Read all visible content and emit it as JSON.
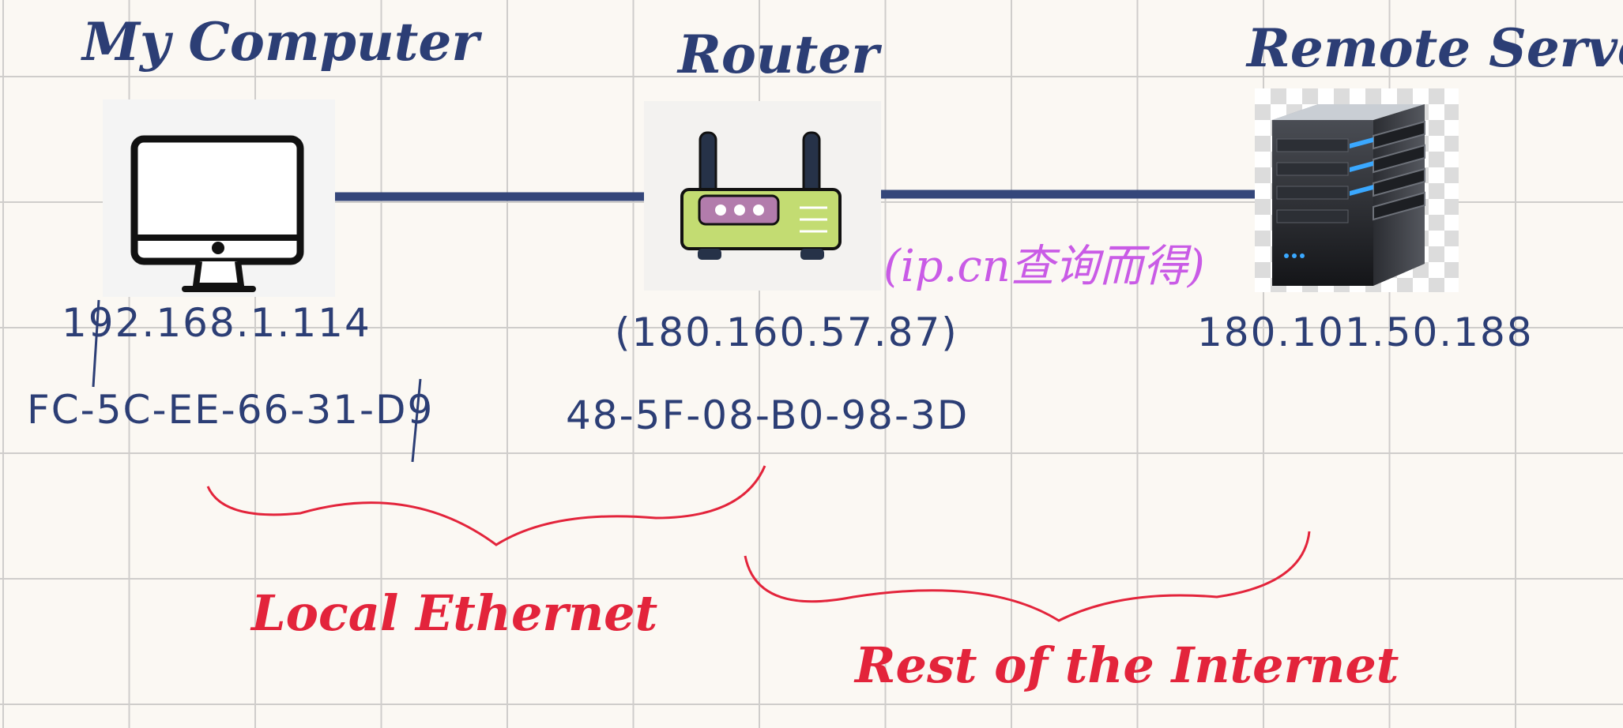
{
  "nodes": {
    "computer": {
      "title": "My Computer",
      "ip": "192.168.1.114",
      "mac": "FC-5C-EE-66-31-D9"
    },
    "router": {
      "title": "Router",
      "ip": "(180.160.57.87)",
      "mac": "48-5F-08-B0-98-3D"
    },
    "server": {
      "title": "Remote Server",
      "ip": "180.101.50.188"
    }
  },
  "note": "(ip.cn查询而得)",
  "segments": {
    "local": "Local Ethernet",
    "internet": "Rest of the Internet"
  },
  "colors": {
    "ink_blue": "#2c3e75",
    "ink_red": "#e3243b",
    "ink_pink": "#c95be6",
    "link_line": "#34467a"
  }
}
